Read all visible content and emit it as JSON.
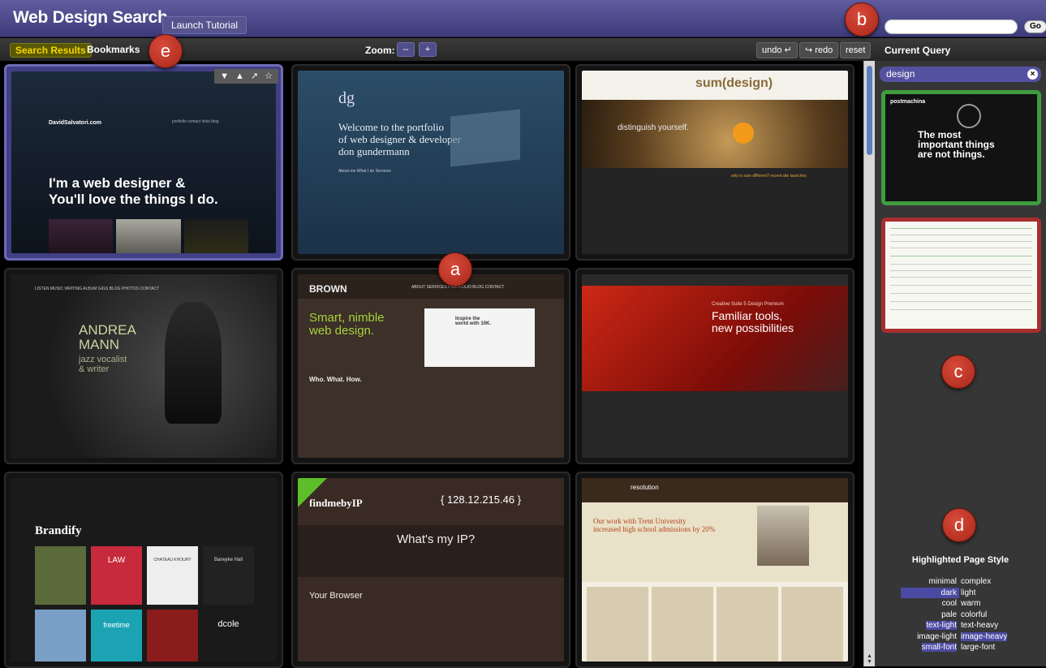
{
  "app": {
    "title": "Web Design Search",
    "tutorial_button": "Launch Tutorial",
    "search_value": "",
    "go_button": "Go"
  },
  "toolbar": {
    "tabs": [
      "Search Results",
      "Bookmarks"
    ],
    "active_tab": "Search Results",
    "zoom_label": "Zoom:",
    "zoom_out": "--",
    "zoom_in": "+",
    "undo": "undo ↵",
    "redo": "↪ redo",
    "reset": "reset",
    "current_query_label": "Current Query"
  },
  "colors": {
    "header": "#4a4888",
    "active_tab_text": "#f5d600",
    "selected_tile": "#6e6cb6",
    "query_chip": "#5452a0",
    "positive_example": "#3f9c3f",
    "negative_example": "#a82e2e",
    "marker": "#c0392b"
  },
  "tile_actions": [
    "▼",
    "▲",
    "↗",
    "☆"
  ],
  "results": [
    {
      "title": "I'm a web designer &\nYou'll love the things I do.",
      "brand": "DavidSalvatori.com",
      "nav": "portfolio  contact  links  blog",
      "selected": true
    },
    {
      "title": "Welcome to the portfolio\nof web designer & developer\ndon gundermann",
      "brand": "dg",
      "nav": "About me   What I do   Services"
    },
    {
      "title": "distinguish yourself.",
      "brand": "sum(design)",
      "nav": "why is sum different?   recent site launches"
    },
    {
      "title": "ANDREA\nMANN",
      "subtitle": "jazz vocalist\n& writer",
      "nav": "LISTEN   MUSIC   WRITING   ALBUM   GIGS   BLOG   PHOTOS   CONTACT"
    },
    {
      "title": "Smart, nimble\nweb design.",
      "brand": "BROWN",
      "nav": "ABOUT  SERVICES  PORTFOLIO  BLOG  CONTACT",
      "subtitle": "Who. What. How.",
      "extra": "Inspire the\nworld with 10K."
    },
    {
      "title": "Familiar tools,\nnew possibilities",
      "subtitle": "Creative Suite 5 Design Premium"
    },
    {
      "title": "Brandify",
      "items": [
        "LAW",
        "CHATEAU KHOURY",
        "Barwyke Hall",
        "freetime",
        "dcole"
      ]
    },
    {
      "title": "What's my IP?",
      "brand": "findmebyIP",
      "subtitle": "{ 128.12.215.46 }",
      "extra": "Your Browser"
    },
    {
      "title": "Our work with Trent University\nincreased high school admissions by 20%",
      "brand": "resolution"
    }
  ],
  "query": {
    "term": "design",
    "remove_icon": "close-icon",
    "positive_example": {
      "brand": "postmachina",
      "title": "The most\nimportant things\nare not things."
    },
    "negative_example": {
      "label": "text-heavy page"
    }
  },
  "style_panel": {
    "title": "Highlighted Page Style",
    "pairs": [
      {
        "left": "minimal",
        "right": "complex",
        "highlight": ""
      },
      {
        "left": "dark",
        "right": "light",
        "highlight": "left"
      },
      {
        "left": "cool",
        "right": "warm",
        "highlight": ""
      },
      {
        "left": "pale",
        "right": "colorful",
        "highlight": ""
      },
      {
        "left": "text-light",
        "right": "text-heavy",
        "highlight": "left"
      },
      {
        "left": "image-light",
        "right": "image-heavy",
        "highlight": "right"
      },
      {
        "left": "small-font",
        "right": "large-font",
        "highlight": "left"
      }
    ]
  },
  "markers": [
    "a",
    "b",
    "c",
    "d",
    "e"
  ]
}
